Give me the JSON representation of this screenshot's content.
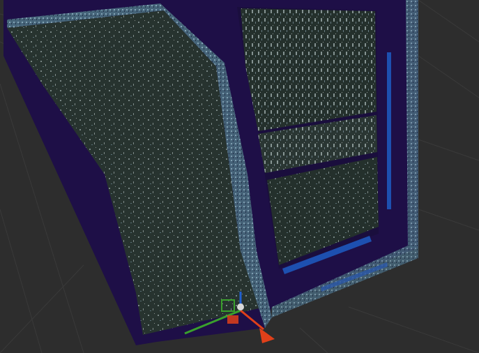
{
  "app": {
    "view": "3d-viewport",
    "background_color": "#2d2d2d",
    "grid_color": "#3a3a3a"
  },
  "scene": {
    "object": "window-frame-point-cloud",
    "frame_color": "#1e0f47",
    "frame_edge_color": "#5a7f95",
    "panel_color": "#27332f",
    "speckle_color": "#b8c8c8",
    "glass_accent_color": "#1d50b0"
  },
  "gizmo": {
    "name": "transform-gizmo",
    "axis_colors": {
      "x": "#e0401a",
      "y": "#3aa02c",
      "z": "#2060d0"
    },
    "icons": [
      "move-arrow-icon",
      "axis-x-handle-icon",
      "axis-y-handle-icon",
      "axis-z-handle-icon"
    ]
  }
}
